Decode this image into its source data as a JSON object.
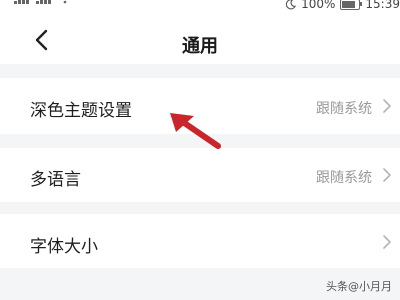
{
  "status_bar": {
    "battery_text": "100%",
    "time": "15:39"
  },
  "nav": {
    "title": "通用"
  },
  "settings": {
    "items": [
      {
        "label": "深色主题设置",
        "value": "跟随系统"
      },
      {
        "label": "多语言",
        "value": "跟随系统"
      },
      {
        "label": "字体大小",
        "value": ""
      }
    ]
  },
  "watermark": "头条@小月月",
  "colors": {
    "background": "#ffffff",
    "section_gap": "#f4f5f7",
    "secondary_text": "#999999",
    "annotation_arrow": "#c8262a"
  },
  "icons": {
    "back": "chevron-left-icon",
    "row_chevron": "chevron-right-icon",
    "annotation": "red-pointer-arrow"
  }
}
